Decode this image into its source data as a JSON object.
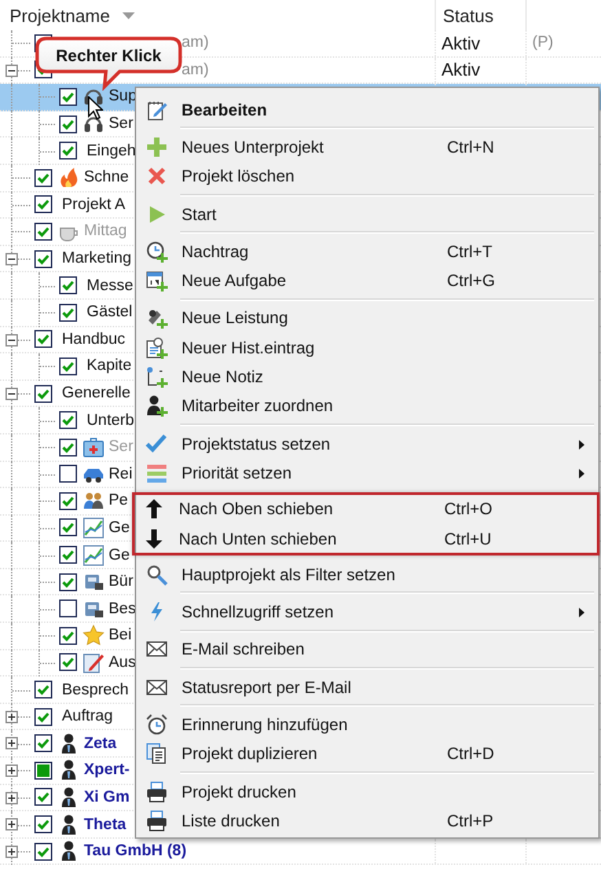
{
  "columns": [
    {
      "label": "Projektname"
    },
    {
      "label": "Status"
    }
  ],
  "callout": "Rechter Klick",
  "tree": [
    {
      "note": "am)",
      "status": "Aktiv",
      "column_3": "(P)",
      "kind": "plain",
      "selected": false
    },
    {
      "note": "am)",
      "status": "Aktiv",
      "checked": true,
      "partial": false,
      "expanded": true,
      "kind": "plain",
      "selected": false,
      "children": [
        {
          "name": "Sup",
          "checked": true,
          "partial": false,
          "kind": "headset",
          "disabled": false,
          "selected": true
        },
        {
          "name": "Ser",
          "checked": true,
          "partial": false,
          "kind": "headset",
          "disabled": false,
          "selected": false
        },
        {
          "name": "Eingeh",
          "checked": true,
          "partial": false,
          "kind": "plain",
          "disabled": false,
          "selected": false
        }
      ]
    },
    {
      "name": "Schne",
      "checked": true,
      "partial": false,
      "kind": "flame",
      "disabled": false,
      "selected": false
    },
    {
      "name": "Projekt A",
      "checked": true,
      "partial": false,
      "kind": "plain",
      "disabled": false,
      "selected": false
    },
    {
      "name": "Mittag",
      "checked": true,
      "partial": false,
      "kind": "cup",
      "disabled": true,
      "selected": false
    },
    {
      "name": "Marketing",
      "checked": true,
      "partial": false,
      "expanded": true,
      "kind": "plain",
      "disabled": false,
      "selected": false,
      "children": [
        {
          "name": "Messe",
          "checked": true,
          "partial": false,
          "kind": "plain",
          "disabled": false,
          "selected": false
        },
        {
          "name": "Gästel",
          "checked": true,
          "partial": false,
          "kind": "plain",
          "disabled": false,
          "selected": false
        }
      ]
    },
    {
      "name": "Handbuc",
      "checked": true,
      "partial": false,
      "expanded": true,
      "kind": "plain",
      "disabled": false,
      "selected": false,
      "children": [
        {
          "name": "Kapite",
          "checked": true,
          "partial": false,
          "kind": "plain",
          "disabled": false,
          "selected": false
        }
      ]
    },
    {
      "name": "Generelle",
      "checked": true,
      "partial": false,
      "expanded": true,
      "kind": "plain",
      "disabled": false,
      "selected": false,
      "children": [
        {
          "name": "Unterb",
          "checked": true,
          "partial": false,
          "kind": "plain",
          "disabled": false,
          "selected": false
        },
        {
          "name": "Ser",
          "checked": true,
          "partial": false,
          "kind": "case",
          "disabled": true,
          "selected": false
        },
        {
          "name": "Rei",
          "checked": false,
          "partial": false,
          "kind": "car",
          "disabled": false,
          "selected": false
        },
        {
          "name": "Pe",
          "checked": true,
          "partial": false,
          "kind": "people",
          "disabled": false,
          "selected": false
        },
        {
          "name": "Ge",
          "checked": true,
          "partial": false,
          "kind": "chart",
          "disabled": false,
          "selected": false
        },
        {
          "name": "Ge",
          "checked": true,
          "partial": false,
          "kind": "chart",
          "disabled": false,
          "selected": false
        },
        {
          "name": "Bür",
          "checked": true,
          "partial": false,
          "kind": "machine",
          "disabled": false,
          "selected": false
        },
        {
          "name": "Bes",
          "checked": false,
          "partial": false,
          "kind": "machine",
          "disabled": false,
          "selected": false
        },
        {
          "name": "Bei",
          "checked": true,
          "partial": false,
          "kind": "star",
          "disabled": false,
          "selected": false
        },
        {
          "name": "Aus",
          "checked": true,
          "partial": false,
          "kind": "pen",
          "disabled": false,
          "selected": false
        }
      ]
    },
    {
      "name": "Besprech",
      "checked": true,
      "partial": false,
      "kind": "plain",
      "disabled": false,
      "selected": false
    },
    {
      "name": "Auftrag",
      "checked": true,
      "partial": false,
      "expanded": false,
      "kind": "plain",
      "disabled": false,
      "selected": false
    },
    {
      "name": "Zeta",
      "checked": true,
      "partial": false,
      "expanded": false,
      "kind": "person",
      "disabled": false,
      "selected": false
    },
    {
      "name": "Xpert-",
      "checked": false,
      "partial": true,
      "expanded": false,
      "kind": "person",
      "disabled": false,
      "selected": false
    },
    {
      "name": "Xi Gm",
      "checked": true,
      "partial": false,
      "expanded": false,
      "kind": "person",
      "disabled": false,
      "selected": false
    },
    {
      "name": "Theta",
      "checked": true,
      "partial": false,
      "expanded": false,
      "kind": "person",
      "disabled": false,
      "selected": false
    },
    {
      "name": "Tau GmbH (8)",
      "checked": true,
      "partial": false,
      "expanded": false,
      "kind": "person",
      "disabled": false,
      "selected": false
    }
  ],
  "context_menu": {
    "sections": [
      {
        "highlighted": false,
        "items": [
          {
            "label": "Bearbeiten",
            "kind": "edit",
            "default": true,
            "submenu": false
          }
        ]
      },
      {
        "highlighted": false,
        "items": [
          {
            "label": "Neues Unterprojekt",
            "kind": "add",
            "shortcut": "Ctrl+N",
            "default": false,
            "submenu": false
          },
          {
            "label": "Projekt löschen",
            "kind": "delete",
            "default": false,
            "submenu": false
          }
        ]
      },
      {
        "highlighted": false,
        "items": [
          {
            "label": "Start",
            "kind": "start",
            "default": false,
            "submenu": false
          }
        ]
      },
      {
        "highlighted": false,
        "items": [
          {
            "label": "Nachtrag",
            "kind": "clock_add",
            "shortcut": "Ctrl+T",
            "default": false,
            "submenu": false
          },
          {
            "label": "Neue Aufgabe",
            "kind": "calendar_add",
            "shortcut": "Ctrl+G",
            "default": false,
            "submenu": false
          }
        ]
      },
      {
        "highlighted": false,
        "items": [
          {
            "label": "Neue Leistung",
            "kind": "tools_add",
            "default": false,
            "submenu": false
          },
          {
            "label": "Neuer Hist.eintrag",
            "kind": "history_add",
            "default": false,
            "submenu": false
          },
          {
            "label": "Neue Notiz",
            "kind": "note_add",
            "default": false,
            "submenu": false
          },
          {
            "label": "Mitarbeiter zuordnen",
            "kind": "person_add",
            "default": false,
            "submenu": false
          }
        ]
      },
      {
        "highlighted": false,
        "items": [
          {
            "label": "Projektstatus setzen",
            "kind": "status",
            "default": false,
            "submenu": true
          },
          {
            "label": "Priorität setzen",
            "kind": "priority",
            "default": false,
            "submenu": true
          }
        ]
      },
      {
        "highlighted": true,
        "items": [
          {
            "label": "Nach Oben schieben",
            "kind": "up",
            "shortcut": "Ctrl+O",
            "default": false,
            "submenu": false
          },
          {
            "label": "Nach Unten schieben",
            "kind": "down",
            "shortcut": "Ctrl+U",
            "default": false,
            "submenu": false
          }
        ]
      },
      {
        "highlighted": false,
        "items": [
          {
            "label": "Hauptprojekt als Filter setzen",
            "kind": "filter",
            "default": false,
            "submenu": false
          }
        ]
      },
      {
        "highlighted": false,
        "items": [
          {
            "label": "Schnellzugriff setzen",
            "kind": "quick",
            "default": false,
            "submenu": true
          }
        ]
      },
      {
        "highlighted": false,
        "items": [
          {
            "label": "E-Mail schreiben",
            "kind": "mail",
            "default": false,
            "submenu": false
          }
        ]
      },
      {
        "highlighted": false,
        "items": [
          {
            "label": "Statusreport per E-Mail",
            "kind": "mail",
            "default": false,
            "submenu": false
          }
        ]
      },
      {
        "highlighted": false,
        "items": [
          {
            "label": "Erinnerung hinzufügen",
            "kind": "alarm",
            "default": false,
            "submenu": false
          },
          {
            "label": "Projekt duplizieren",
            "kind": "duplicate",
            "shortcut": "Ctrl+D",
            "default": false,
            "submenu": false
          }
        ]
      },
      {
        "highlighted": false,
        "items": [
          {
            "label": "Projekt drucken",
            "kind": "print",
            "default": false,
            "submenu": false
          },
          {
            "label": "Liste drucken",
            "kind": "print",
            "shortcut": "Ctrl+P",
            "default": false,
            "submenu": false
          }
        ]
      }
    ]
  }
}
